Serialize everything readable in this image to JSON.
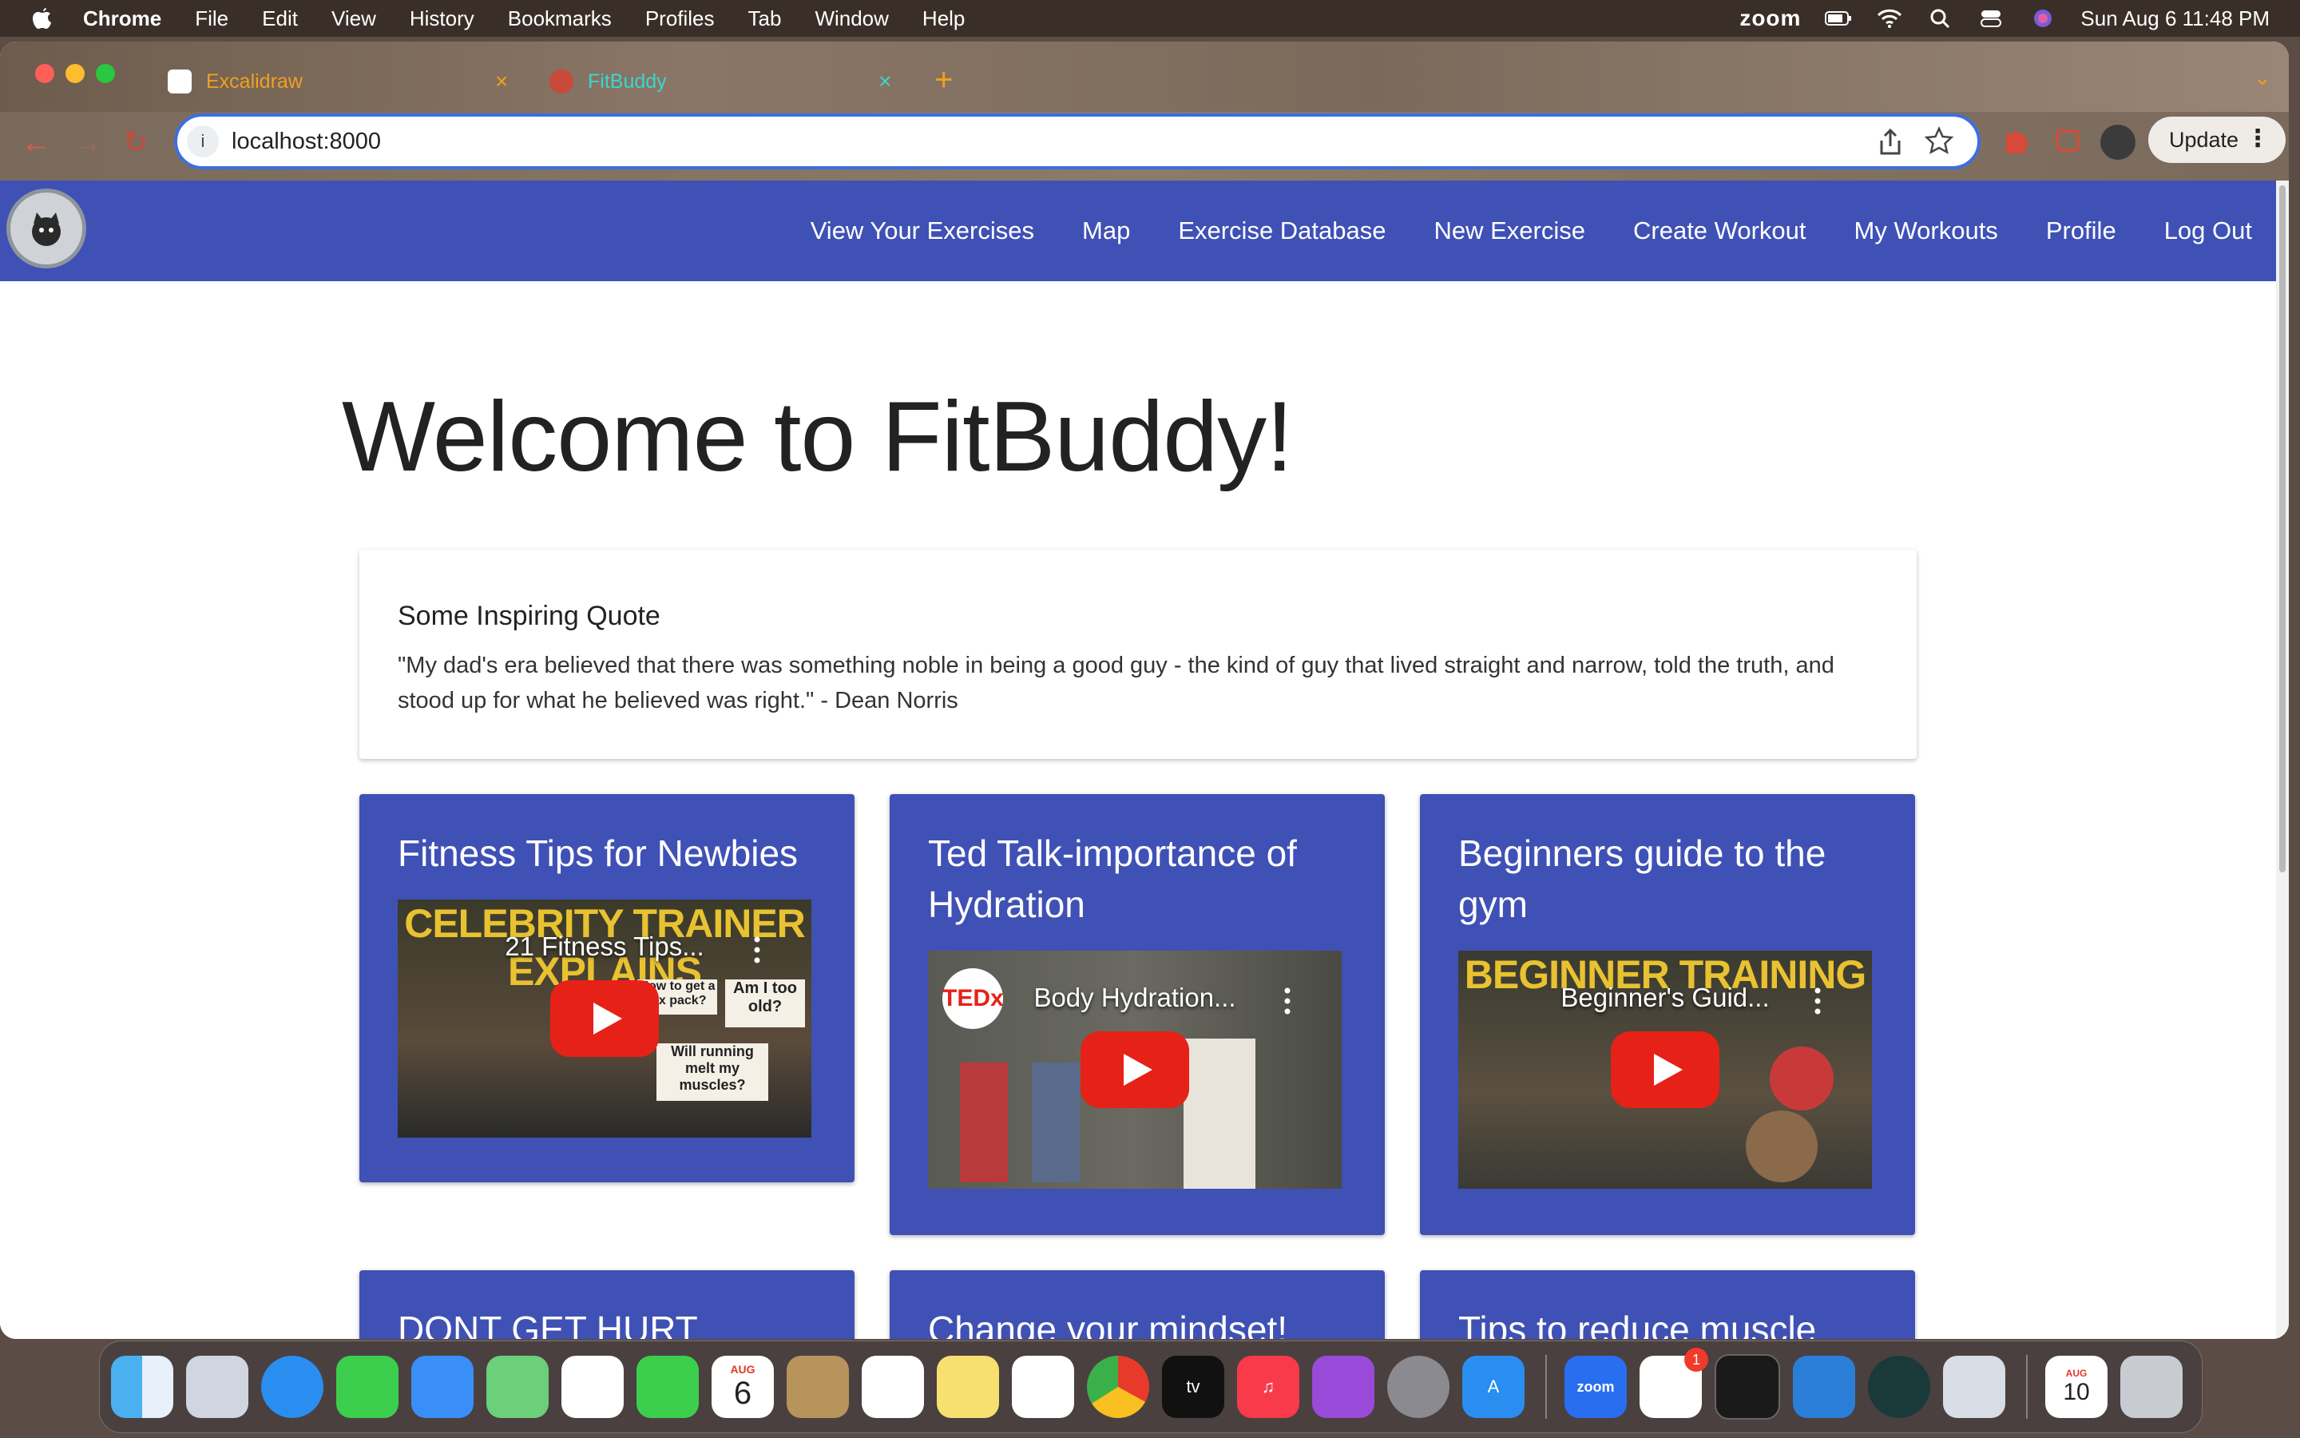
{
  "menubar": {
    "app": "Chrome",
    "items": [
      "File",
      "Edit",
      "View",
      "History",
      "Bookmarks",
      "Profiles",
      "Tab",
      "Window",
      "Help"
    ],
    "zoom_label": "zoom",
    "datetime": "Sun Aug 6  11:48 PM"
  },
  "browser": {
    "tabs": [
      {
        "title": "Excalidraw",
        "color": "#f0a020"
      },
      {
        "title": "FitBuddy",
        "color": "#3ad6d0"
      }
    ],
    "url": "localhost:8000",
    "update_label": "Update"
  },
  "navbar": {
    "links": [
      "View Your Exercises",
      "Map",
      "Exercise Database",
      "New Exercise",
      "Create Workout",
      "My Workouts",
      "Profile",
      "Log Out"
    ],
    "color": "#3f51b5"
  },
  "main": {
    "heading": "Welcome to FitBuddy!",
    "quote": {
      "title": "Some Inspiring Quote",
      "text": "\"My dad's era believed that there was something noble in being a good guy - the kind of guy that lived straight and narrow, told the truth, and stood up for what he believed was right.\" - Dean Norris"
    },
    "videos": [
      {
        "title": "Fitness Tips for Newbies",
        "video_title": "21 Fitness Tips...",
        "banner": "CELEBRITY TRAINER EXPLAINS",
        "notes": [
          "How to get a six pack?",
          "Am I too old?",
          "Will running melt my muscles?"
        ]
      },
      {
        "title": "Ted Talk-importance of Hydration",
        "video_title": "Body Hydration...",
        "banner": "TEDx"
      },
      {
        "title": "Beginners guide to the gym",
        "video_title": "Beginner's Guid...",
        "banner": "BEGINNER TRAINING"
      },
      {
        "title": "DONT GET HURT"
      },
      {
        "title": "Change your mindset!"
      },
      {
        "title": "Tips to reduce muscle soreness"
      }
    ]
  },
  "dock": {
    "apps": [
      "finder",
      "launchpad",
      "safari",
      "messages",
      "mail",
      "maps",
      "photos",
      "facetime",
      "calendar",
      "contacts",
      "reminders",
      "notes",
      "freeform",
      "chrome",
      "tv",
      "music",
      "podcasts",
      "settings",
      "app-store",
      "zoom",
      "slack",
      "terminal",
      "vscode",
      "gitkraken",
      "preview",
      "calendar-file",
      "trash"
    ],
    "calendar_month": "AUG",
    "calendar_day": "6",
    "zoom_label": "zoom",
    "slack_badge": "1",
    "file_month": "AUG",
    "file_day": "10"
  }
}
